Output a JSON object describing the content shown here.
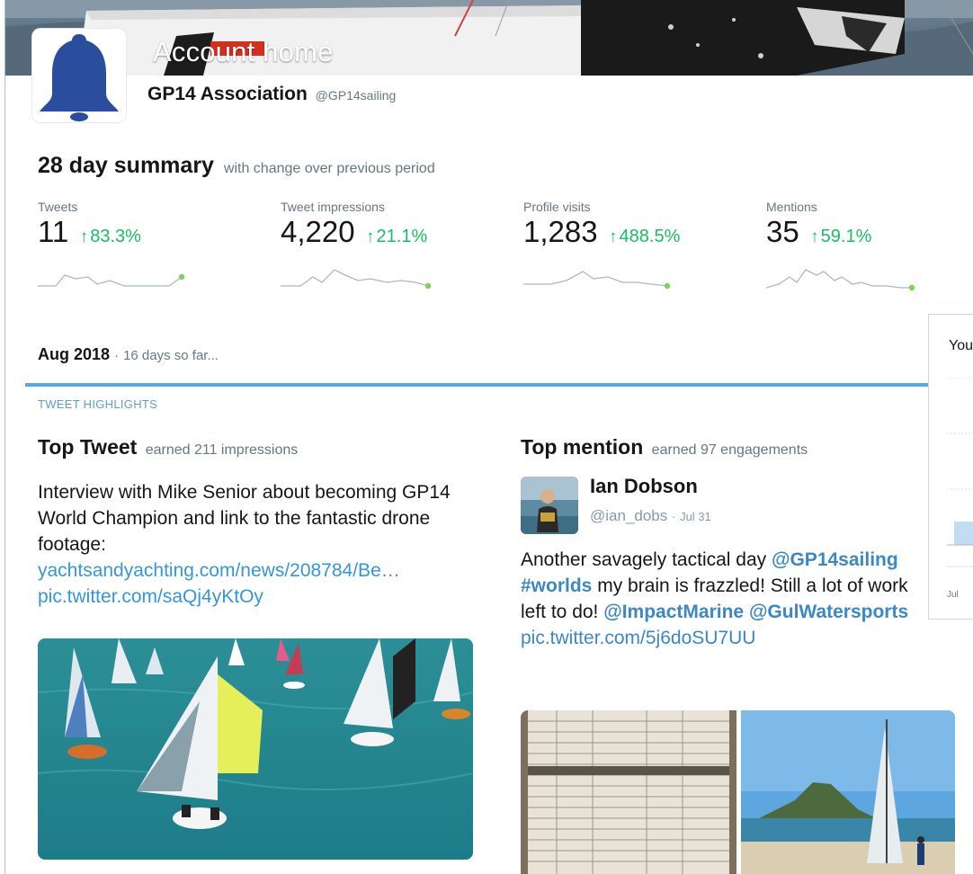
{
  "header": {
    "title": "Account home",
    "account_name": "GP14 Association",
    "account_handle": "@GP14sailing"
  },
  "summary": {
    "title": "28 day summary",
    "subtitle": "with change over previous period",
    "metrics": [
      {
        "label": "Tweets",
        "value": "11",
        "change": "83.3%",
        "arrow": "↑"
      },
      {
        "label": "Tweet impressions",
        "value": "4,220",
        "change": "21.1%",
        "arrow": "↑"
      },
      {
        "label": "Profile visits",
        "value": "1,283",
        "change": "488.5%",
        "arrow": "↑"
      },
      {
        "label": "Mentions",
        "value": "35",
        "change": "59.1%",
        "arrow": "↑"
      }
    ]
  },
  "period": {
    "month": "Aug 2018",
    "separator": "·",
    "note": "16 days so far..."
  },
  "highlights_label": "TWEET HIGHLIGHTS",
  "top_tweet": {
    "title": "Top Tweet",
    "subtitle": "earned 211 impressions",
    "text": "Interview with Mike Senior about becoming GP14 World Champion and link to the fantastic drone footage:",
    "link": "yachtsandyachting.com/news/208784/Be…",
    "pic_link": "pic.twitter.com/saQj4yKtOy"
  },
  "top_mention": {
    "title": "Top mention",
    "subtitle": "earned 97 engagements",
    "author_name": "Ian Dobson",
    "author_handle": "@ian_dobs",
    "meta_separator": "·",
    "date": "Jul 31",
    "text_part1": "Another savagely tactical day",
    "mention1": "@GP14sailing",
    "hashtag": "#worlds",
    "text_part2": "my brain is frazzled! Still a lot of work left to do!",
    "mention2": "@ImpactMarine",
    "mention3": "@GulWatersports",
    "pic_link": "pic.twitter.com/5j6doSU7UU"
  },
  "side_card": {
    "title": "You",
    "axis_label": "Jul"
  },
  "colors": {
    "positive": "#17bf63",
    "link": "#3596d8",
    "accent_rule": "#59a8e1",
    "avatar_bell": "#2a4d9e"
  }
}
